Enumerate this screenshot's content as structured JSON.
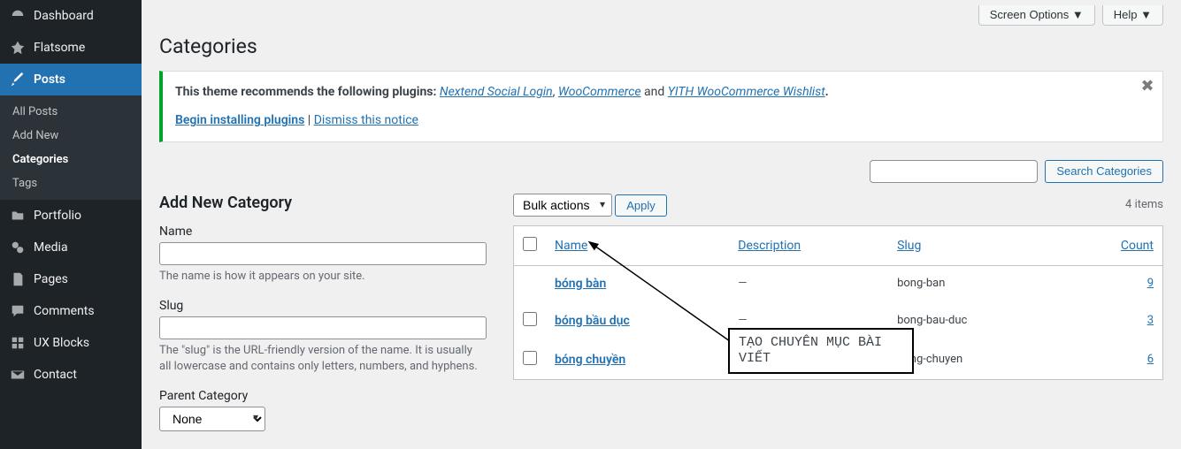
{
  "sidebar": {
    "items": [
      {
        "label": "Dashboard",
        "icon": "dashboard"
      },
      {
        "label": "Flatsome",
        "icon": "flatsome"
      },
      {
        "label": "Posts",
        "icon": "posts",
        "current": true
      },
      {
        "label": "Portfolio",
        "icon": "portfolio"
      },
      {
        "label": "Media",
        "icon": "media"
      },
      {
        "label": "Pages",
        "icon": "pages"
      },
      {
        "label": "Comments",
        "icon": "comments"
      },
      {
        "label": "UX Blocks",
        "icon": "uxblocks"
      },
      {
        "label": "Contact",
        "icon": "contact"
      }
    ],
    "submenu": [
      {
        "label": "All Posts"
      },
      {
        "label": "Add New"
      },
      {
        "label": "Categories",
        "active": true
      },
      {
        "label": "Tags"
      }
    ]
  },
  "topbar": {
    "screen_options": "Screen Options ▼",
    "help": "Help ▼"
  },
  "page_title": "Categories",
  "notice": {
    "text_before": "This theme recommends the following plugins: ",
    "plugin1": "Nextend Social Login",
    "sep1": ", ",
    "plugin2": "WooCommerce",
    "sep2": " and ",
    "plugin3": "YITH WooCommerce Wishlist",
    "period": ".",
    "begin": "Begin installing plugins",
    "pipe": " | ",
    "dismiss": "Dismiss this notice"
  },
  "search": {
    "button": "Search Categories"
  },
  "bulk": {
    "label": "Bulk actions",
    "apply": "Apply"
  },
  "items_count": "4 items",
  "form": {
    "heading": "Add New Category",
    "name_label": "Name",
    "name_help": "The name is how it appears on your site.",
    "slug_label": "Slug",
    "slug_help": "The \"slug\" is the URL-friendly version of the name. It is usually all lowercase and contains only letters, numbers, and hyphens.",
    "parent_label": "Parent Category",
    "parent_option": "None"
  },
  "table": {
    "headers": {
      "name": "Name",
      "description": "Description",
      "slug": "Slug",
      "count": "Count"
    },
    "rows": [
      {
        "name": "bóng bàn",
        "description": "—",
        "slug": "bong-ban",
        "count": "9"
      },
      {
        "name": "bóng bầu dục",
        "description": "—",
        "slug": "bong-bau-duc",
        "count": "3"
      },
      {
        "name": "bóng chuyền",
        "description": "—",
        "slug": "bong-chuyen",
        "count": "6"
      }
    ]
  },
  "annotation": "TẠO CHUYÊN MỤC BÀI VIẾT"
}
